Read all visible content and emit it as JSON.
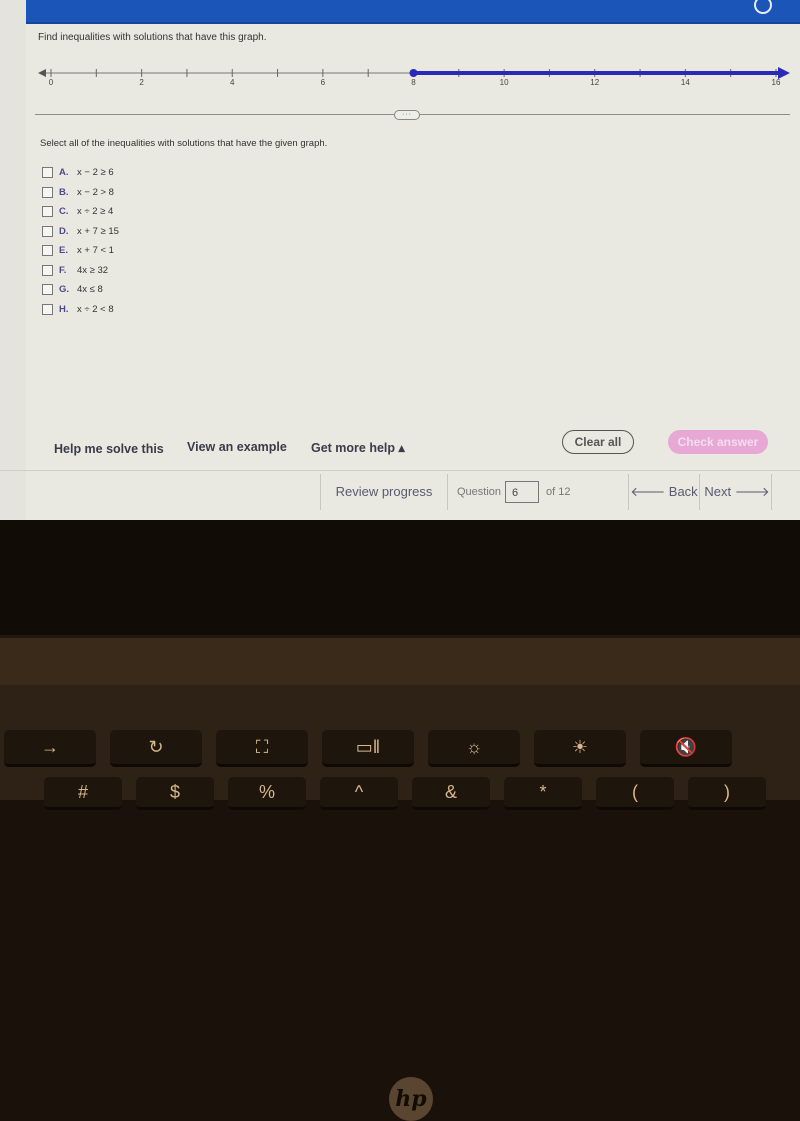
{
  "header": {
    "settings_icon": "gear-icon"
  },
  "question": {
    "prompt": "Find inequalities with solutions that have this graph.",
    "instruction": "Select all of the inequalities with solutions that have the given graph.",
    "options": [
      {
        "letter": "A.",
        "text": "x − 2 ≥ 6",
        "checked": false
      },
      {
        "letter": "B.",
        "text": "x − 2 > 8",
        "checked": false
      },
      {
        "letter": "C.",
        "text": "x ÷ 2 ≥ 4",
        "checked": false
      },
      {
        "letter": "D.",
        "text": "x + 7 ≥ 15",
        "checked": false
      },
      {
        "letter": "E.",
        "text": "x + 7 < 1",
        "checked": false
      },
      {
        "letter": "F.",
        "text": "4x ≥ 32",
        "checked": false
      },
      {
        "letter": "G.",
        "text": "4x ≤ 8",
        "checked": false
      },
      {
        "letter": "H.",
        "text": "x ÷ 2 < 8",
        "checked": false
      }
    ],
    "drag_handle": "···"
  },
  "number_line": {
    "min": 0,
    "max": 16,
    "tick_step": 1,
    "label_step": 2,
    "labels": [
      "0",
      "2",
      "4",
      "6",
      "8",
      "10",
      "12",
      "14",
      "16"
    ],
    "solution_start": 8,
    "start_closed": true,
    "direction": "right",
    "line_color": "#2a2ab8"
  },
  "help": {
    "help_me_solve": "Help me solve this",
    "view_example": "View an example",
    "get_more_help": "Get more help ▴"
  },
  "actions": {
    "clear_all": "Clear all",
    "check_answer": "Check answer"
  },
  "navigation": {
    "review_progress": "Review progress",
    "question_label": "Question",
    "question_number": "6",
    "of_total": "of 12",
    "back": "🡐 Back",
    "next": "Next 🡒"
  },
  "laptop": {
    "logo": "hp",
    "top_keys": [
      "→",
      "↻",
      "⛶",
      "▭‖",
      "☼",
      "☀",
      "🔇"
    ],
    "bottom_keys": [
      "#",
      "$",
      "%",
      "^",
      "&",
      "*",
      "(",
      ")"
    ]
  }
}
